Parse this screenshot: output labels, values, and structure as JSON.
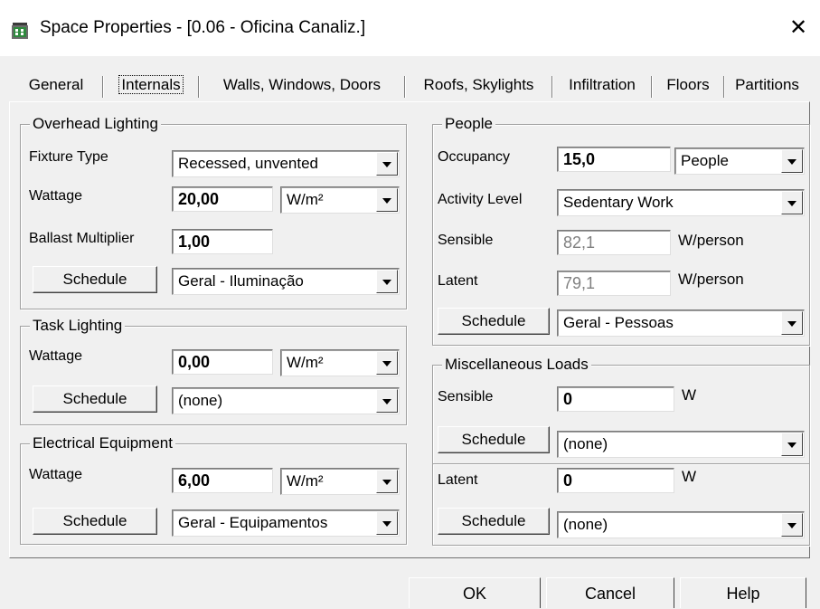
{
  "window": {
    "title": "Space Properties - [0.06 - Oficina Canaliz.]",
    "close_glyph": "✕",
    "icon": "building-icon"
  },
  "tabs": [
    {
      "label": "General"
    },
    {
      "label": "Internals"
    },
    {
      "label": "Walls, Windows, Doors"
    },
    {
      "label": "Roofs, Skylights"
    },
    {
      "label": "Infiltration"
    },
    {
      "label": "Floors"
    },
    {
      "label": "Partitions"
    }
  ],
  "active_tab": "Internals",
  "overhead_lighting": {
    "title": "Overhead Lighting",
    "fixture_type_label": "Fixture Type",
    "fixture_type_value": "Recessed, unvented",
    "wattage_label": "Wattage",
    "wattage_value": "20,00",
    "wattage_unit": "W/m²",
    "ballast_label": "Ballast Multiplier",
    "ballast_value": "1,00",
    "schedule_button": "Schedule",
    "schedule_value": "Geral - Iluminação"
  },
  "task_lighting": {
    "title": "Task Lighting",
    "wattage_label": "Wattage",
    "wattage_value": "0,00",
    "wattage_unit": "W/m²",
    "schedule_button": "Schedule",
    "schedule_value": "(none)"
  },
  "electrical_equipment": {
    "title": "Electrical Equipment",
    "wattage_label": "Wattage",
    "wattage_value": "6,00",
    "wattage_unit": "W/m²",
    "schedule_button": "Schedule",
    "schedule_value": "Geral - Equipamentos"
  },
  "people": {
    "title": "People",
    "occupancy_label": "Occupancy",
    "occupancy_value": "15,0",
    "occupancy_unit": "People",
    "activity_label": "Activity Level",
    "activity_value": "Sedentary Work",
    "sensible_label": "Sensible",
    "sensible_value": "82,1",
    "sensible_unit": "W/person",
    "latent_label": "Latent",
    "latent_value": "79,1",
    "latent_unit": "W/person",
    "schedule_button": "Schedule",
    "schedule_value": "Geral - Pessoas"
  },
  "misc_loads": {
    "title": "Miscellaneous Loads",
    "sensible_label": "Sensible",
    "sensible_value": "0",
    "sensible_unit": "W",
    "sensible_schedule_button": "Schedule",
    "sensible_schedule_value": "(none)",
    "latent_label": "Latent",
    "latent_value": "0",
    "latent_unit": "W",
    "latent_schedule_button": "Schedule",
    "latent_schedule_value": "(none)"
  },
  "buttons": {
    "ok": "OK",
    "cancel": "Cancel",
    "help": "Help"
  }
}
